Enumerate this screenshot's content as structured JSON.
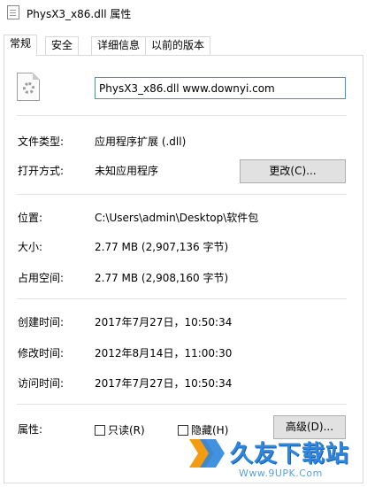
{
  "window": {
    "title": "PhysX3_x86.dll 属性"
  },
  "tabs": [
    {
      "label": "常规",
      "active": true
    },
    {
      "label": "安全",
      "active": false
    },
    {
      "label": "详细信息",
      "active": false
    },
    {
      "label": "以前的版本",
      "active": false
    }
  ],
  "general": {
    "file_name": "PhysX3_x86.dll www.downyi.com",
    "file_type": {
      "label": "文件类型:",
      "value": "应用程序扩展 (.dll)"
    },
    "opens_with": {
      "label": "打开方式:",
      "value": "未知应用程序",
      "change_button": "更改(C)..."
    },
    "location": {
      "label": "位置:",
      "value": "C:\\Users\\admin\\Desktop\\软件包"
    },
    "size": {
      "label": "大小:",
      "value": "2.77 MB (2,907,136 字节)"
    },
    "size_on_disk": {
      "label": "占用空间:",
      "value": "2.77 MB (2,908,160 字节)"
    },
    "created": {
      "label": "创建时间:",
      "value": "2017年7月27日，10:50:34"
    },
    "modified": {
      "label": "修改时间:",
      "value": "2012年8月14日，11:00:30"
    },
    "accessed": {
      "label": "访问时间:",
      "value": "2017年7月27日，10:50:34"
    },
    "attributes": {
      "label": "属性:",
      "read_only": {
        "label": "只读(R)",
        "checked": false
      },
      "hidden": {
        "label": "隐藏(H)",
        "checked": false
      },
      "advanced_button": "高级(D)..."
    }
  },
  "watermark": {
    "brand": "久友下载站",
    "url": "Www.9UPK.Com"
  },
  "colors": {
    "input_border": "#3a8ee6",
    "button_face": "#e1e1e1",
    "watermark_blue": "#2e86de"
  }
}
